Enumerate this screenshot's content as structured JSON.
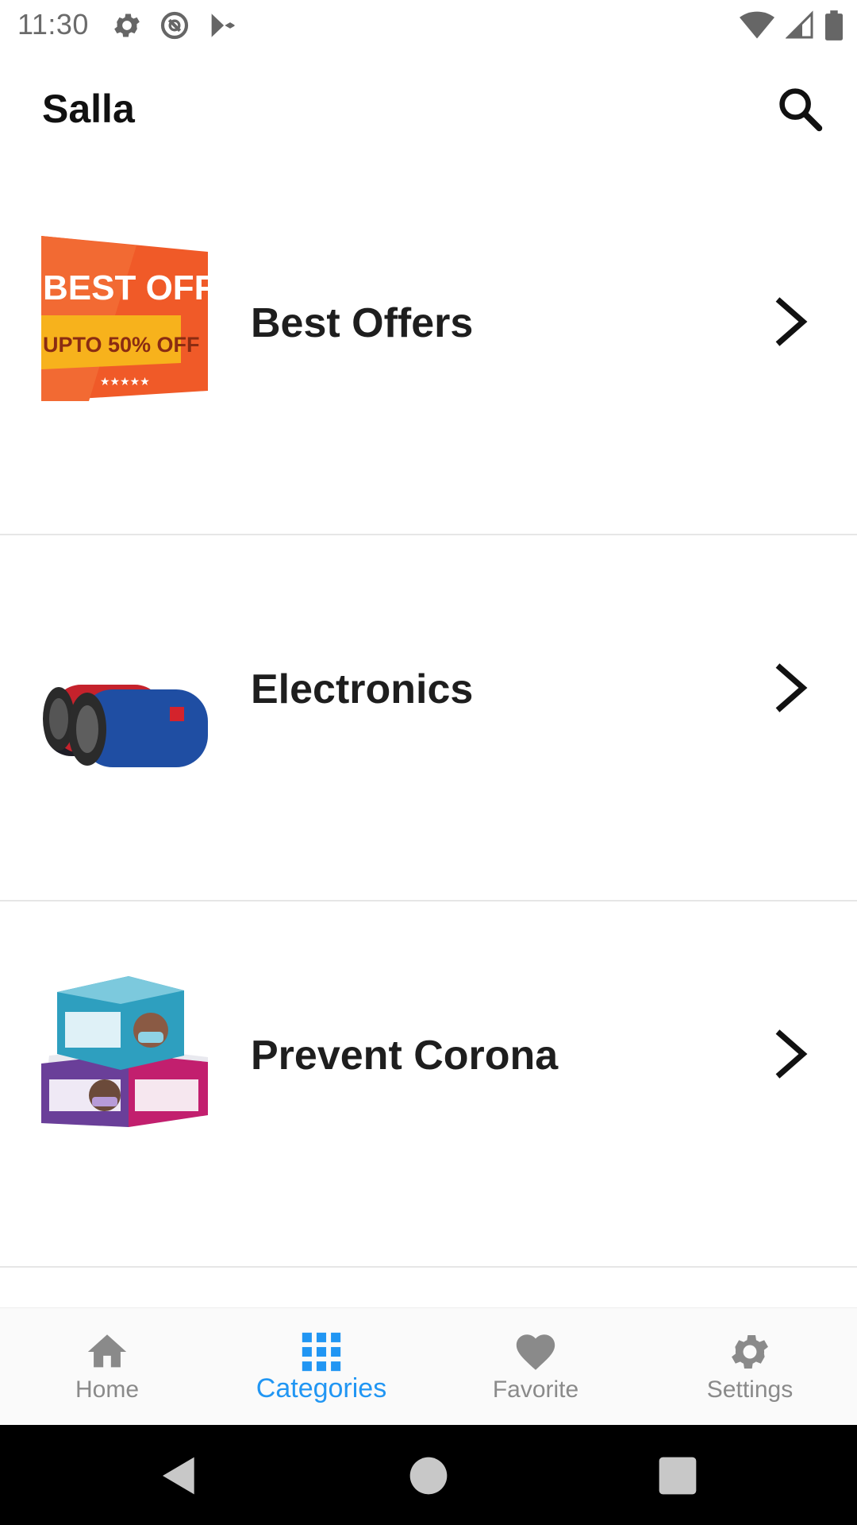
{
  "status_bar": {
    "time": "11:30",
    "icons_left": [
      "gear-icon",
      "sync-disabled-icon",
      "play-store-icon"
    ],
    "icons_right": [
      "wifi-icon",
      "signal-icon",
      "battery-icon"
    ]
  },
  "app_bar": {
    "title": "Salla",
    "search_icon": "search-icon"
  },
  "categories": [
    {
      "label": "Best Offers",
      "thumb_text_1": "BEST OFFER",
      "thumb_text_2": "UPTO 50% OFF",
      "thumb_text_3": "★★★★★"
    },
    {
      "label": "Electronics"
    },
    {
      "label": "Prevent Corona"
    }
  ],
  "bottom_nav": {
    "items": [
      {
        "label": "Home",
        "icon": "home-icon",
        "active": false
      },
      {
        "label": "Categories",
        "icon": "grid-icon",
        "active": true
      },
      {
        "label": "Favorite",
        "icon": "heart-icon",
        "active": false
      },
      {
        "label": "Settings",
        "icon": "gear-icon",
        "active": false
      }
    ],
    "active_color": "#2196f3",
    "inactive_color": "#8a8a8a"
  },
  "system_nav": {
    "buttons": [
      "back-icon",
      "home-circle-icon",
      "recents-icon"
    ]
  }
}
